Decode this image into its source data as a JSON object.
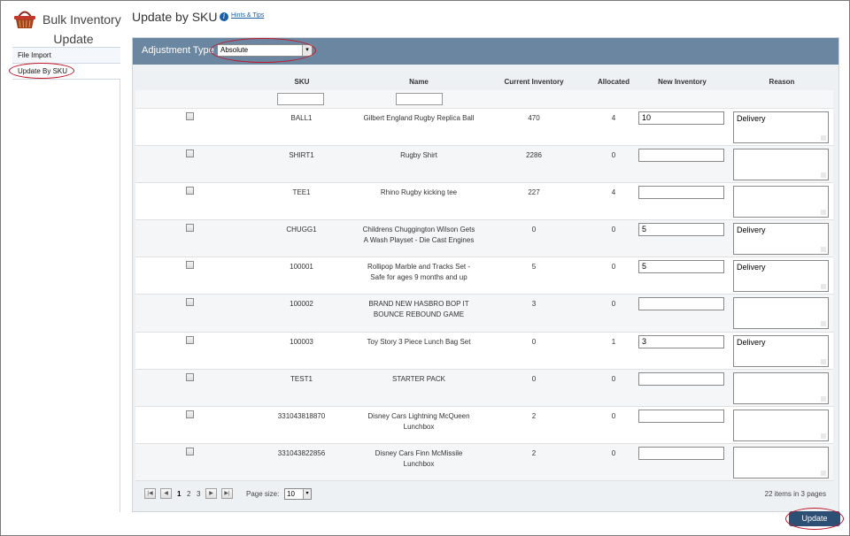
{
  "app": {
    "title_line1": "Bulk Inventory",
    "title_line2": "Update"
  },
  "sidebar": {
    "items": [
      {
        "label": "File Import"
      },
      {
        "label": "Update By SKU"
      }
    ]
  },
  "header": {
    "title": "Update by SKU",
    "hints_label": "Hints & Tips",
    "info_glyph": "i"
  },
  "adjustment": {
    "label": "Adjustment Type",
    "selected": "Absolute",
    "arrow": "▾"
  },
  "columns": {
    "sku": "SKU",
    "name": "Name",
    "current": "Current Inventory",
    "allocated": "Allocated",
    "new_inventory": "New Inventory",
    "reason": "Reason"
  },
  "rows": [
    {
      "sku": "BALL1",
      "name": "Gilbert England Rugby Replica Ball",
      "current": "470",
      "allocated": "4",
      "new_inventory": "10",
      "reason": "Delivery"
    },
    {
      "sku": "SHIRT1",
      "name": "Rugby Shirt",
      "current": "2286",
      "allocated": "0",
      "new_inventory": "",
      "reason": ""
    },
    {
      "sku": "TEE1",
      "name": "Rhino Rugby kicking tee",
      "current": "227",
      "allocated": "4",
      "new_inventory": "",
      "reason": ""
    },
    {
      "sku": "CHUGG1",
      "name": "Childrens Chuggington Wilson Gets A Wash Playset - Die Cast Engines",
      "current": "0",
      "allocated": "0",
      "new_inventory": "5",
      "reason": "Delivery"
    },
    {
      "sku": "100001",
      "name": "Rollipop Marble and Tracks Set - Safe for ages 9 months and up",
      "current": "5",
      "allocated": "0",
      "new_inventory": "5",
      "reason": "Delivery"
    },
    {
      "sku": "100002",
      "name": "BRAND NEW HASBRO BOP IT BOUNCE REBOUND GAME",
      "current": "3",
      "allocated": "0",
      "new_inventory": "",
      "reason": ""
    },
    {
      "sku": "100003",
      "name": "Toy Story 3 Piece Lunch Bag Set",
      "current": "0",
      "allocated": "1",
      "new_inventory": "3",
      "reason": "Delivery"
    },
    {
      "sku": "TEST1",
      "name": "STARTER PACK",
      "current": "0",
      "allocated": "0",
      "new_inventory": "",
      "reason": ""
    },
    {
      "sku": "331043818870",
      "name": "Disney Cars Lightning McQueen Lunchbox",
      "current": "2",
      "allocated": "0",
      "new_inventory": "",
      "reason": ""
    },
    {
      "sku": "331043822856",
      "name": "Disney Cars Finn McMissile Lunchbox",
      "current": "2",
      "allocated": "0",
      "new_inventory": "",
      "reason": ""
    }
  ],
  "pager": {
    "first": "|◀",
    "prev": "◀",
    "next": "▶",
    "last": "▶|",
    "pages": [
      "1",
      "2",
      "3"
    ],
    "current_page": "1",
    "page_size_label": "Page size:",
    "page_size": "10",
    "size_arrow": "▾",
    "summary": "22 items in 3 pages"
  },
  "actions": {
    "update_label": "Update"
  },
  "colors": {
    "header_bar": "#6b86a1",
    "button": "#2d4f74",
    "highlight_oval": "#c0182a"
  }
}
